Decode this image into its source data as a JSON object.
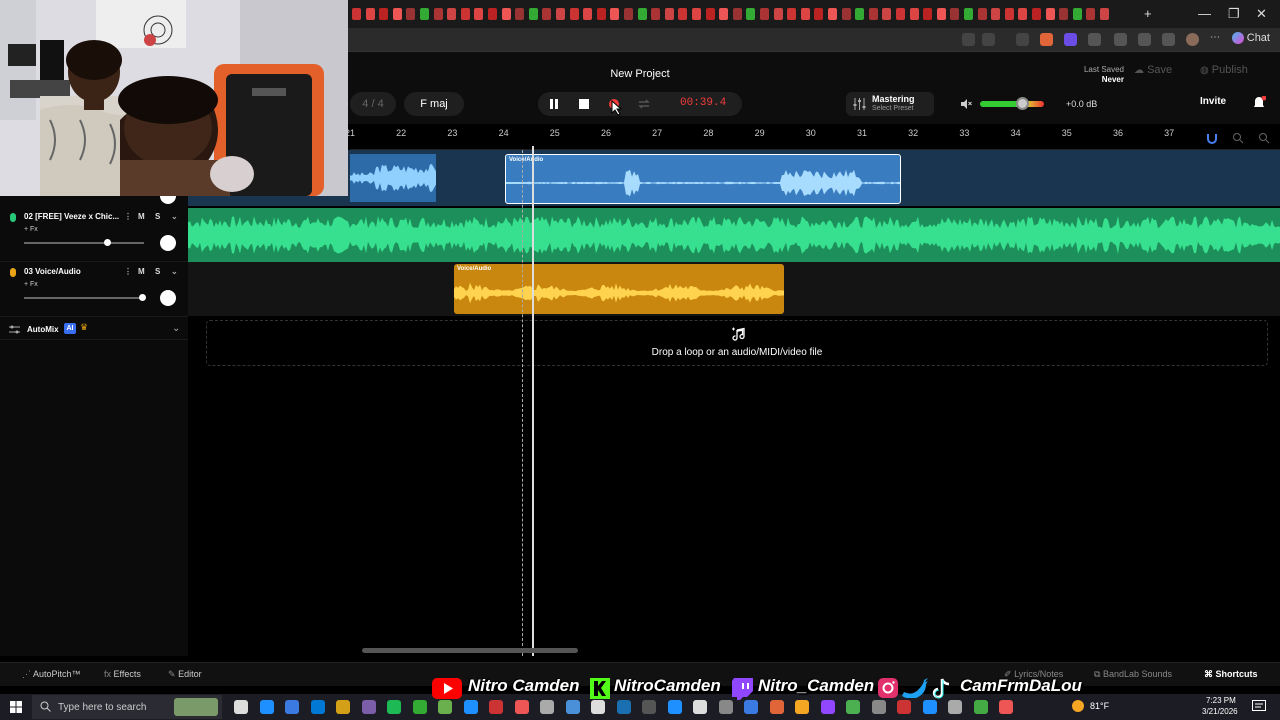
{
  "browser": {
    "chat_label": "Chat",
    "window_controls": [
      "—",
      "❐",
      "✕"
    ]
  },
  "header": {
    "project_title": "New Project",
    "time_signature": "4 / 4",
    "key": "F maj",
    "time_readout": "00:39.4",
    "mastering_title": "Mastering",
    "mastering_sub": "Select Preset",
    "db_readout": "+0.0 dB",
    "last_saved_label": "Last Saved",
    "last_saved_value": "Never",
    "save_label": "Save",
    "publish_label": "Publish",
    "invite_label": "Invite",
    "notification_count": "1"
  },
  "ruler": {
    "ticks": [
      "21",
      "22",
      "23",
      "24",
      "25",
      "26",
      "27",
      "28",
      "29",
      "30",
      "31",
      "32",
      "33",
      "34",
      "35",
      "36",
      "37"
    ]
  },
  "tracks": [
    {
      "name": "02 [FREE] Veeze x Chic...",
      "fx": "+ Fx",
      "mute": "M",
      "solo": "S",
      "color": "#28c878"
    },
    {
      "name": "03 Voice/Audio",
      "fx": "+ Fx",
      "mute": "M",
      "solo": "S",
      "color": "#e8a317"
    }
  ],
  "automix": {
    "label": "AutoMix",
    "badge": "AI"
  },
  "clips": {
    "voice_clip_label": "Voice/Audio",
    "voice_clip_blue_label": "Voice/Audio"
  },
  "drop_zone": {
    "text": "Drop a loop or an audio/MIDI/video file"
  },
  "bottombar": {
    "autopitch": "AutoPitch™",
    "effects": "Effects",
    "editor": "Editor",
    "lyrics": "Lyrics/Notes",
    "bandlab_sounds": "BandLab Sounds",
    "shortcuts": "Shortcuts"
  },
  "social": {
    "youtube": "Nitro Camden",
    "kick": "NitroCamden",
    "twitch": "Nitro_Camden",
    "other": "CamFrmDaLou"
  },
  "taskbar": {
    "search_placeholder": "Type here to search",
    "temperature": "81°F",
    "time": "7:23 PM",
    "date": "3/21/2026"
  },
  "colors": {
    "accent_red": "#f23c3c",
    "track_green": "#28c878",
    "track_yellow": "#e8a317",
    "track_blue": "#3f8fe0"
  }
}
